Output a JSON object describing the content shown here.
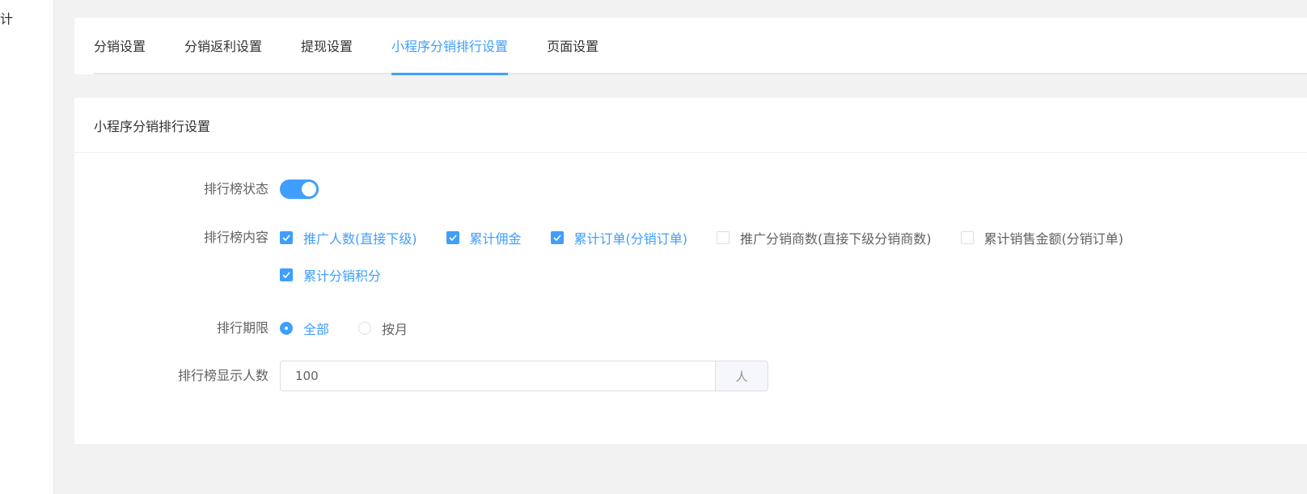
{
  "sidebar": {
    "fragment": "计"
  },
  "tabs": [
    {
      "label": "分销设置"
    },
    {
      "label": "分销返利设置"
    },
    {
      "label": "提现设置"
    },
    {
      "label": "小程序分销排行设置",
      "active": true
    },
    {
      "label": "页面设置"
    }
  ],
  "card": {
    "title": "小程序分销排行设置"
  },
  "form": {
    "status_label": "排行榜状态",
    "status_on": true,
    "content_label": "排行榜内容",
    "content_options": [
      {
        "label": "推广人数(直接下级)",
        "checked": true
      },
      {
        "label": "累计佣金",
        "checked": true
      },
      {
        "label": "累计订单(分销订单)",
        "checked": true
      },
      {
        "label": "推广分销商数(直接下级分销商数)",
        "checked": false
      },
      {
        "label": "累计销售金额(分销订单)",
        "checked": false
      },
      {
        "label": "累计分销积分",
        "checked": true
      }
    ],
    "period_label": "排行期限",
    "period_options": [
      {
        "label": "全部",
        "selected": true
      },
      {
        "label": "按月",
        "selected": false
      }
    ],
    "count_label": "排行榜显示人数",
    "count_value": "100",
    "count_unit": "人"
  },
  "colors": {
    "accent": "#409eff"
  }
}
